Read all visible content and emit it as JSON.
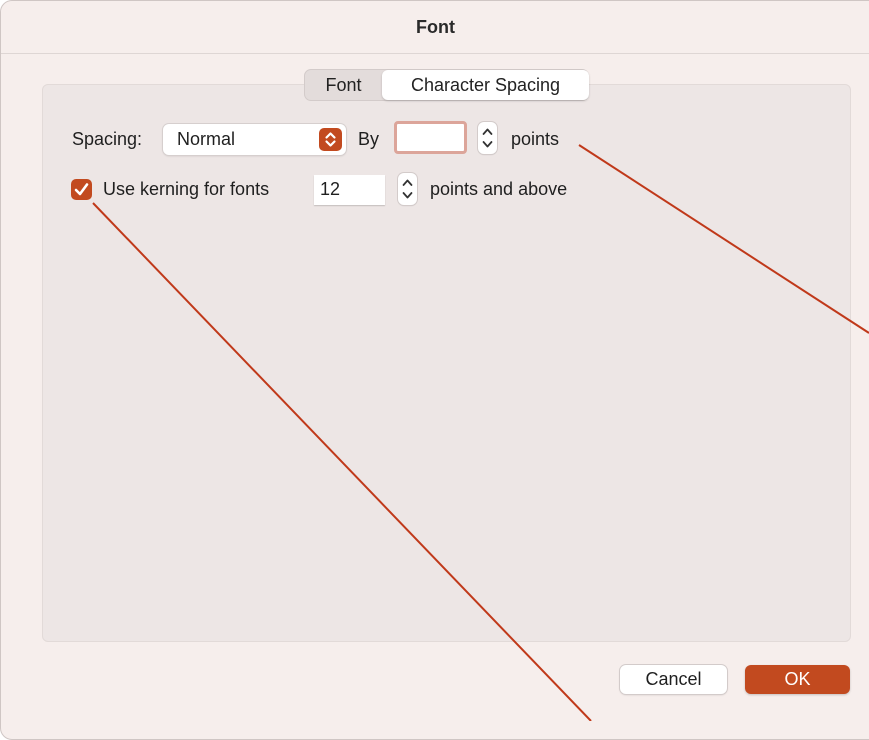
{
  "dialog": {
    "title": "Font"
  },
  "tabs": [
    {
      "label": "Font",
      "selected": false
    },
    {
      "label": "Character Spacing",
      "selected": true
    }
  ],
  "spacing": {
    "label": "Spacing:",
    "selected_value": "Normal",
    "by_label": "By",
    "by_value": "",
    "units_label": "points"
  },
  "kerning": {
    "checked": true,
    "label": "Use kerning for fonts",
    "size_value": "12",
    "suffix_label": "points and above"
  },
  "buttons": {
    "cancel": "Cancel",
    "ok": "OK"
  },
  "colors": {
    "accent": "#c24a1f",
    "window_background": "#f6eeec",
    "panel_background": "#ede6e5",
    "annotation_line": "#c0391a",
    "focus_ring": "#dca59a"
  },
  "icons": {
    "popup": "up-down-chevron-icon",
    "stepper": "stepper-arrows-icon",
    "checkbox": "checkmark-icon"
  }
}
